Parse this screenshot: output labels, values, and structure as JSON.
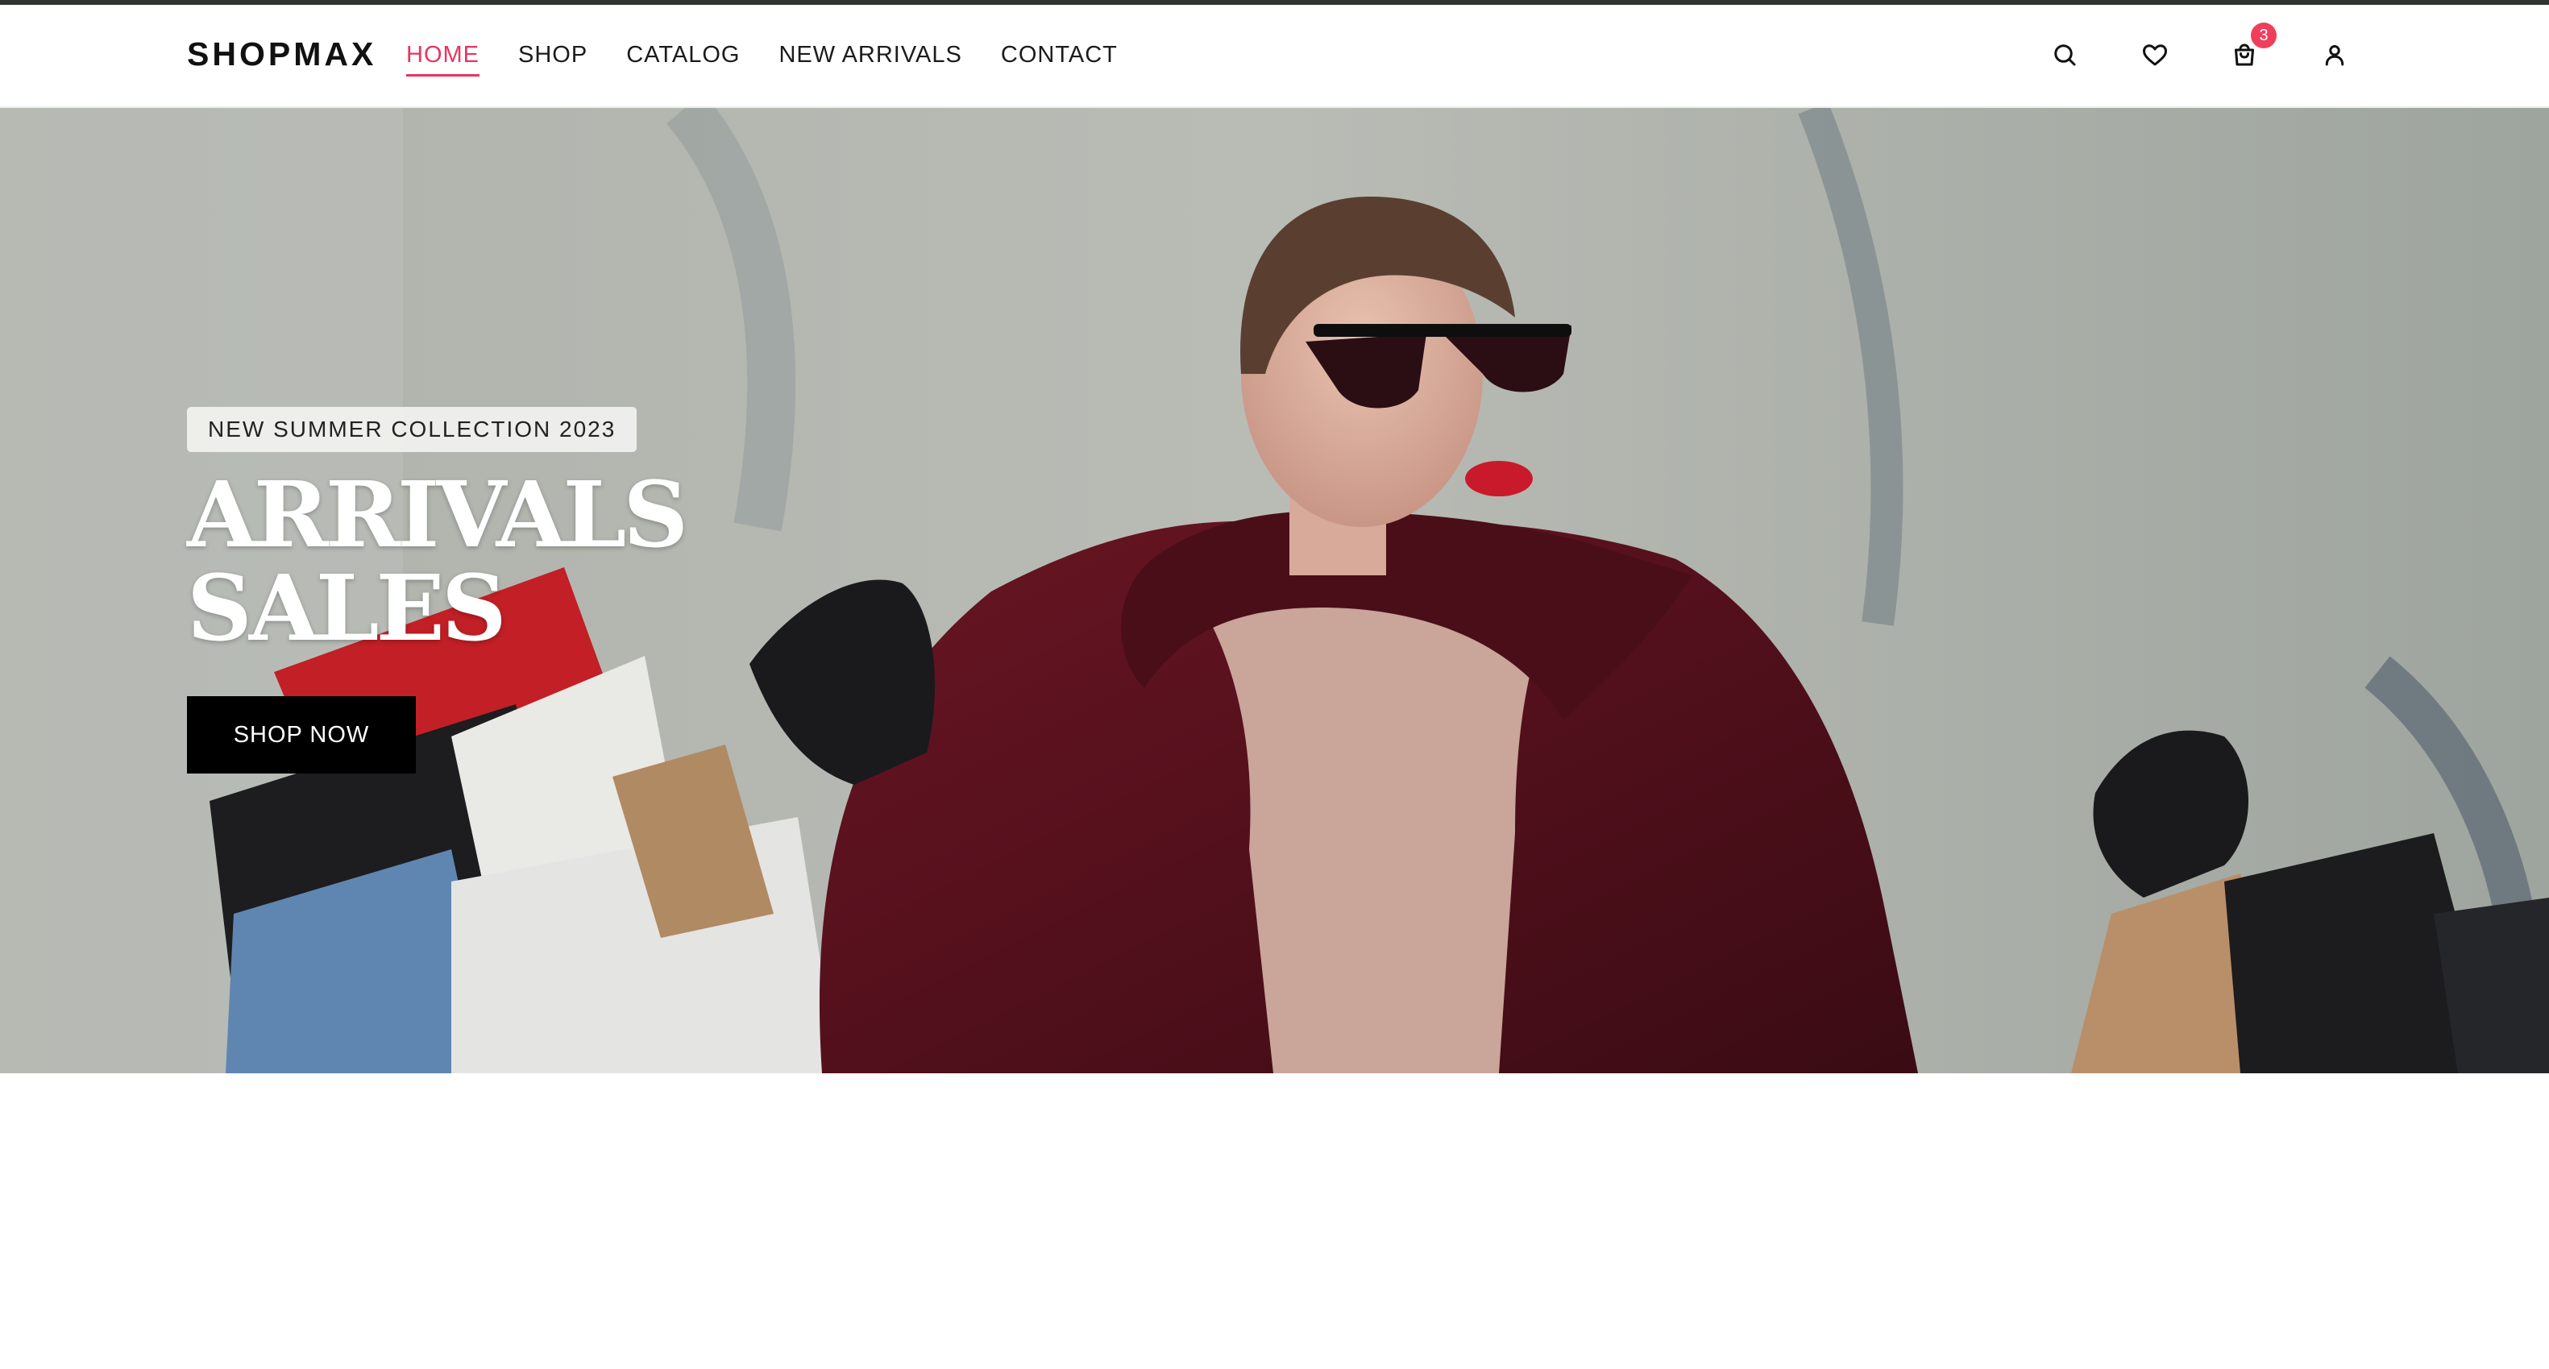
{
  "brand": {
    "name": "SHOPMAX",
    "accent_color": "#e9345e",
    "badge_color": "#ef3e5c"
  },
  "nav": {
    "items": [
      {
        "label": "HOME",
        "active": true
      },
      {
        "label": "SHOP",
        "active": false
      },
      {
        "label": "CATALOG",
        "active": false
      },
      {
        "label": "NEW ARRIVALS",
        "active": false
      },
      {
        "label": "CONTACT",
        "active": false
      }
    ]
  },
  "header_icons": {
    "search": "search-icon",
    "wishlist": "heart-icon",
    "cart": "shopping-bag-icon",
    "cart_count": "3",
    "account": "user-icon"
  },
  "hero": {
    "tag": "NEW SUMMER COLLECTION 2023",
    "title_line1": "ARRIVALS",
    "title_line2": "SALES",
    "cta_label": "SHOP NOW",
    "image": "woman-with-shopping-bags"
  }
}
